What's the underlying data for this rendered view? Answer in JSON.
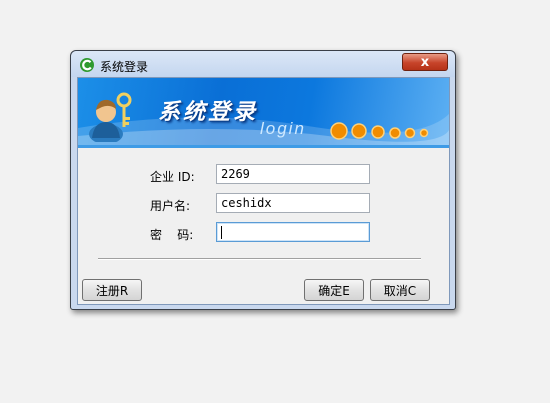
{
  "window": {
    "title": "系统登录",
    "close_label": "x"
  },
  "banner": {
    "title": "系统登录",
    "subtitle": "login"
  },
  "form": {
    "company_id_label": "企业 ID:",
    "company_id_value": "2269",
    "username_label": "用户名:",
    "username_value": "ceshidx",
    "password_label": "密    码:",
    "password_value": ""
  },
  "buttons": {
    "register": "注册R",
    "ok": "确定E",
    "cancel": "取消C"
  },
  "colors": {
    "banner_blue": "#0a6fd6",
    "dot_orange": "#f08c00",
    "close_red": "#c7442a"
  }
}
